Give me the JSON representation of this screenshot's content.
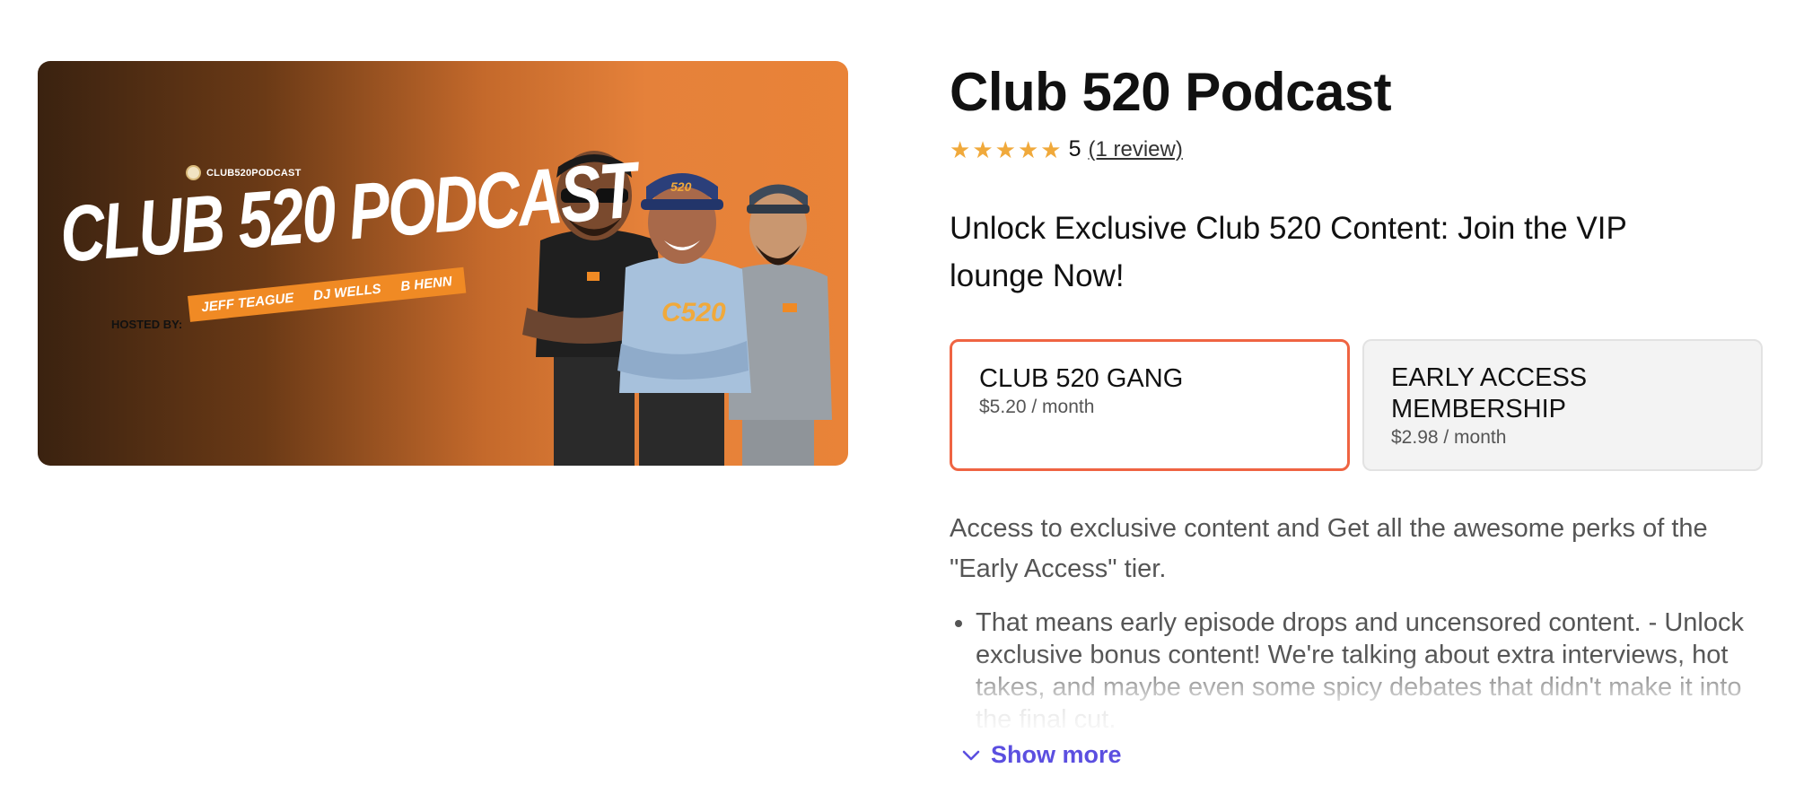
{
  "cover": {
    "handle": "CLUB520PODCAST",
    "title": "CLUB 520 PODCAST",
    "hosted_by": "HOSTED BY:",
    "hosts": [
      "JEFF TEAGUE",
      "DJ WELLS",
      "B HENN"
    ],
    "cap_text": "520"
  },
  "product": {
    "title": "Club 520 Podcast",
    "rating_value": "5",
    "review_link": "(1 review)",
    "star_count": 5,
    "tagline": "Unlock Exclusive Club 520 Content: Join the VIP lounge Now!"
  },
  "tiers": [
    {
      "name": "CLUB 520 GANG",
      "price": "$5.20 / month",
      "selected": true
    },
    {
      "name": "EARLY ACCESS MEMBERSHIP",
      "price": "$2.98 / month",
      "selected": false
    }
  ],
  "description": {
    "intro": "Access to exclusive content and Get all the awesome perks of the \"Early Access\" tier.",
    "perks": [
      "That means early episode drops and uncensored content. - Unlock exclusive bonus content! We're talking about extra interviews, hot takes, and maybe even some spicy debates that didn't make it into the final cut."
    ]
  },
  "show_more": {
    "label": "Show more",
    "icon": "chevron-down-icon"
  },
  "colors": {
    "accent": "#ef6442",
    "link": "#5b4fe0",
    "star": "#f0a93b",
    "cover_orange": "#e98338",
    "cover_dark": "#3a2210"
  }
}
